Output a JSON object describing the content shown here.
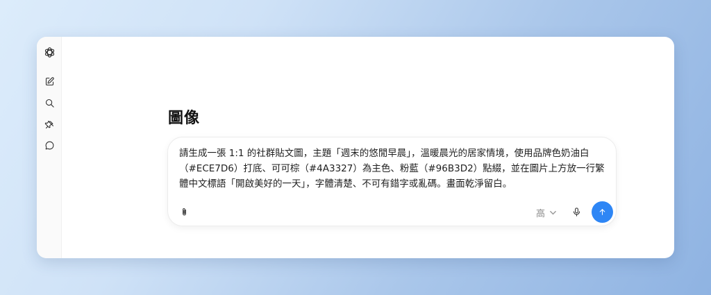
{
  "page": {
    "title": "圖像"
  },
  "sidebar": {
    "items": [
      {
        "name": "logo",
        "icon": "openai-logo-icon"
      },
      {
        "name": "new-chat",
        "icon": "edit-icon"
      },
      {
        "name": "search",
        "icon": "search-icon"
      },
      {
        "name": "pinned",
        "icon": "pin-icon"
      },
      {
        "name": "chats",
        "icon": "chat-bubble-icon"
      }
    ]
  },
  "composer": {
    "prompt_text": "請生成一張 1:1 的社群貼文圖，主題「週末的悠閒早晨」，溫暖晨光的居家情境，使用品牌色奶油白（#ECE7D6）打底、可可棕（#4A3327）為主色、粉藍（#96B3D2）點綴，並在圖片上方放一行繁體中文標語「開啟美好的一天」，字體清楚、不可有錯字或亂碼。畫面乾淨留白。",
    "quality_label": "高",
    "attach_icon": "paperclip-icon",
    "mic_icon": "microphone-icon",
    "send_icon": "arrow-up-icon",
    "send_color": "#2e86f5"
  }
}
